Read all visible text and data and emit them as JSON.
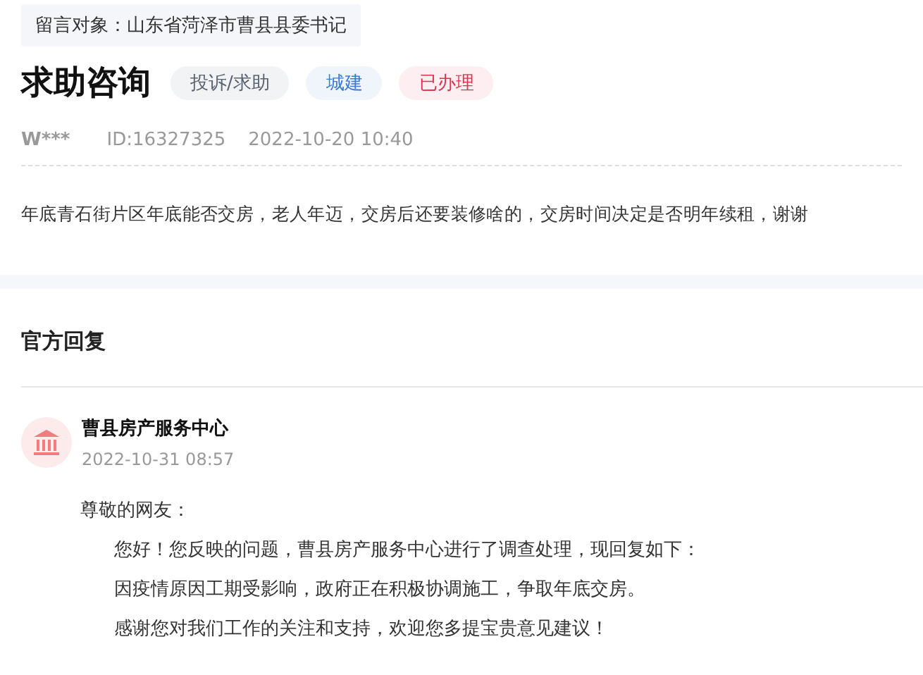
{
  "target": {
    "label": "留言对象：",
    "value": "山东省菏泽市曹县县委书记"
  },
  "title": "求助咨询",
  "tags": [
    {
      "text": "投诉/求助",
      "color": "#5a6372"
    },
    {
      "text": "城建",
      "color": "#3a7bd5"
    },
    {
      "text": "已办理",
      "color": "#e0314b"
    }
  ],
  "meta": {
    "user": "W***",
    "id": "ID:16327325",
    "time": "2022-10-20 10:40"
  },
  "question": "年底青石街片区年底能否交房，老人年迈，交房后还要装修啥的，交房时间决定是否明年续租，谢谢",
  "reply_section": {
    "heading": "官方回复"
  },
  "reply": {
    "org": "曹县房产服务中心",
    "time": "2022-10-31 08:57",
    "greeting": "尊敬的网友：",
    "paragraphs": [
      "您好！您反映的问题，曹县房产服务中心进行了调查处理，现回复如下：",
      "因疫情原因工期受影响，政府正在积极协调施工，争取年底交房。",
      "感谢您对我们工作的关注和支持，欢迎您多提宝贵意见建议！"
    ]
  }
}
